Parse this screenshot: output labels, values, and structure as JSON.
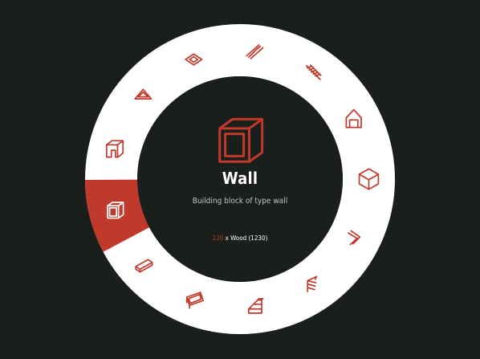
{
  "colors": {
    "background": "#1b1f1b",
    "ring": "#ffffff",
    "accent": "#c0392b",
    "center": "#1b1f1b"
  },
  "menu": {
    "selected_index": 0,
    "items": [
      {
        "icon": "wall-icon"
      },
      {
        "icon": "doorway-icon"
      },
      {
        "icon": "roof-triangle-icon"
      },
      {
        "icon": "floor-tile-icon"
      },
      {
        "icon": "ladder-icon"
      },
      {
        "icon": "stairs-icon"
      },
      {
        "icon": "house-frame-icon"
      },
      {
        "icon": "cube-block-icon"
      },
      {
        "icon": "corner-piece-icon"
      },
      {
        "icon": "spiral-stairs-icon"
      },
      {
        "icon": "ramp-stairs-icon"
      },
      {
        "icon": "window-frame-icon"
      },
      {
        "icon": "beam-icon"
      }
    ]
  },
  "selected": {
    "icon": "wall-icon",
    "name": "Wall",
    "description": "Building block of type wall",
    "cost_quantity": "120",
    "cost_text": " x Wood (1230)"
  }
}
